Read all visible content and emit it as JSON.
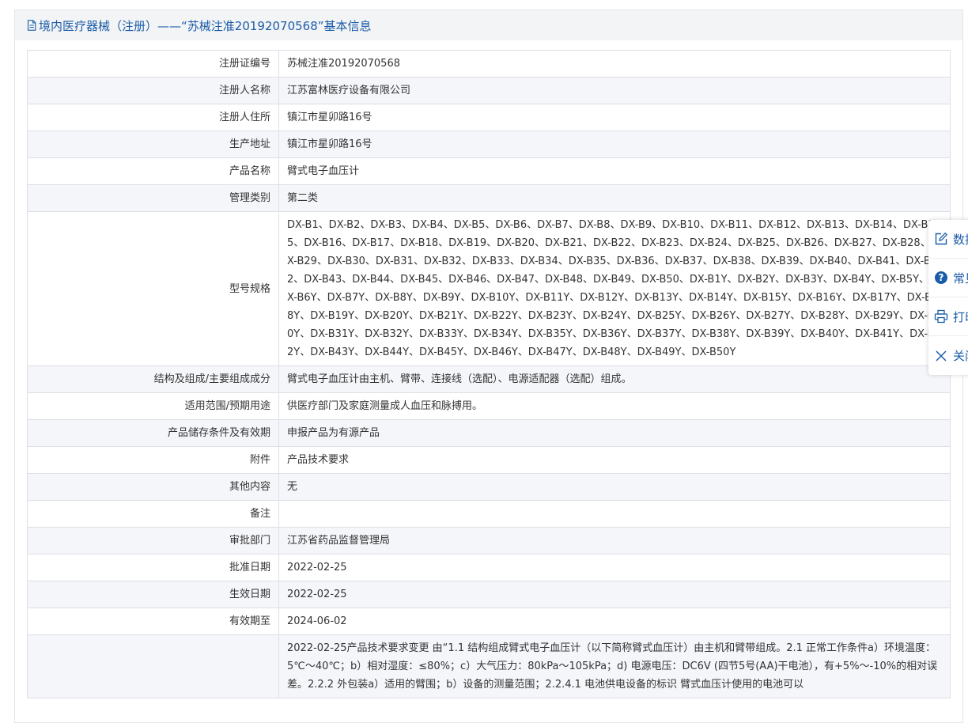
{
  "header": {
    "title": "境内医疗器械（注册）——“苏械注准20192070568”基本信息"
  },
  "rows": [
    {
      "key": "注册证编号",
      "value": "苏械注准20192070568"
    },
    {
      "key": "注册人名称",
      "value": "江苏富林医疗设备有限公司"
    },
    {
      "key": "注册人住所",
      "value": "镇江市星卯路16号"
    },
    {
      "key": "生产地址",
      "value": "镇江市星卯路16号"
    },
    {
      "key": "产品名称",
      "value": "臂式电子血压计"
    },
    {
      "key": "管理类别",
      "value": "第二类"
    },
    {
      "key": "型号规格",
      "value": "DX-B1、DX-B2、DX-B3、DX-B4、DX-B5、DX-B6、DX-B7、DX-B8、DX-B9、DX-B10、DX-B11、DX-B12、DX-B13、DX-B14、DX-B15、DX-B16、DX-B17、DX-B18、DX-B19、DX-B20、DX-B21、DX-B22、DX-B23、DX-B24、DX-B25、DX-B26、DX-B27、DX-B28、DX-B29、DX-B30、DX-B31、DX-B32、DX-B33、DX-B34、DX-B35、DX-B36、DX-B37、DX-B38、DX-B39、DX-B40、DX-B41、DX-B42、DX-B43、DX-B44、DX-B45、DX-B46、DX-B47、DX-B48、DX-B49、DX-B50、DX-B1Y、DX-B2Y、DX-B3Y、DX-B4Y、DX-B5Y、DX-B6Y、DX-B7Y、DX-B8Y、DX-B9Y、DX-B10Y、DX-B11Y、DX-B12Y、DX-B13Y、DX-B14Y、DX-B15Y、DX-B16Y、DX-B17Y、DX-B18Y、DX-B19Y、DX-B20Y、DX-B21Y、DX-B22Y、DX-B23Y、DX-B24Y、DX-B25Y、DX-B26Y、DX-B27Y、DX-B28Y、DX-B29Y、DX-B30Y、DX-B31Y、DX-B32Y、DX-B33Y、DX-B34Y、DX-B35Y、DX-B36Y、DX-B37Y、DX-B38Y、DX-B39Y、DX-B40Y、DX-B41Y、DX-B42Y、DX-B43Y、DX-B44Y、DX-B45Y、DX-B46Y、DX-B47Y、DX-B48Y、DX-B49Y、DX-B50Y",
      "multi": true
    },
    {
      "key": "结构及组成/主要组成成分",
      "value": "臂式电子血压计由主机、臂带、连接线（选配）、电源适配器（选配）组成。"
    },
    {
      "key": "适用范围/预期用途",
      "value": "供医疗部门及家庭测量成人血压和脉搏用。"
    },
    {
      "key": "产品储存条件及有效期",
      "value": "申报产品为有源产品"
    },
    {
      "key": "附件",
      "value": "产品技术要求"
    },
    {
      "key": "其他内容",
      "value": "无"
    },
    {
      "key": "备注",
      "value": ""
    },
    {
      "key": "审批部门",
      "value": "江苏省药品监督管理局"
    },
    {
      "key": "批准日期",
      "value": "2022-02-25"
    },
    {
      "key": "生效日期",
      "value": "2022-02-25"
    },
    {
      "key": "有效期至",
      "value": "2024-06-02"
    },
    {
      "key": "",
      "value": "2022-02-25产品技术要求变更 由“1.1 结构组成臂式电子血压计（以下简称臂式血压计）由主机和臂带组成。2.1 正常工作条件a）环境温度：5℃～40℃；b）相对湿度：≤80%；c）大气压力：80kPa～105kPa；d) 电源电压：DC6V (四节5号(AA)干电池），有+5%～-10%的相对误差。2.2.2 外包装a）适用的臂围；b）设备的测量范围；2.2.4.1 电池供电设备的标识 臂式血压计使用的电池可以",
      "multi": true
    }
  ],
  "side_menu": [
    {
      "label": "数据纠错",
      "icon": "edit-icon"
    },
    {
      "label": "常见问题",
      "icon": "question-circle-icon"
    },
    {
      "label": "打印",
      "icon": "printer-icon"
    },
    {
      "label": "关闭",
      "icon": "close-icon"
    }
  ]
}
